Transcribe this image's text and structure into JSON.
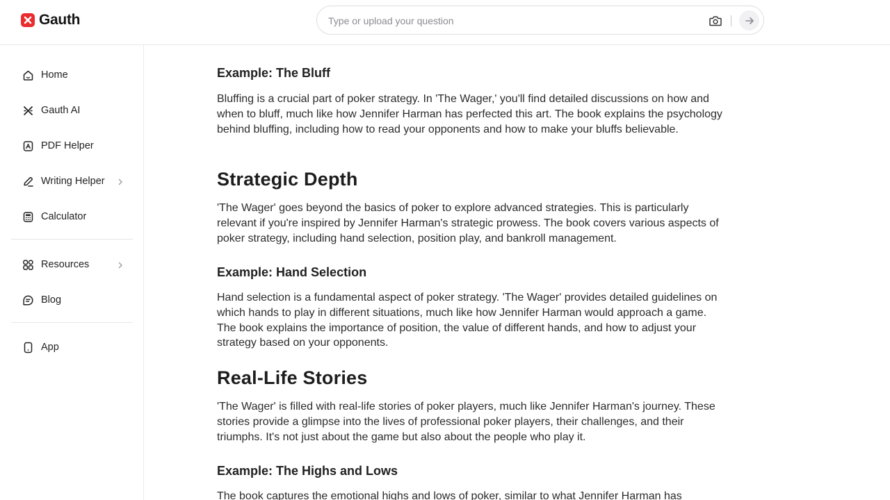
{
  "brand": {
    "name": "Gauth",
    "color": "#ea2c2f"
  },
  "search": {
    "placeholder": "Type or upload your question"
  },
  "icons": {
    "camera": "camera-icon",
    "send": "arrow-right-icon"
  },
  "sidebar": {
    "items": [
      {
        "label": "Home",
        "icon": "home-icon"
      },
      {
        "label": "Gauth AI",
        "icon": "gauth-ai-icon"
      },
      {
        "label": "PDF Helper",
        "icon": "pdf-icon"
      },
      {
        "label": "Writing Helper",
        "icon": "pen-icon",
        "has_submenu": true
      },
      {
        "label": "Calculator",
        "icon": "calculator-icon"
      },
      {
        "label": "Resources",
        "icon": "grid-icon",
        "has_submenu": true
      },
      {
        "label": "Blog",
        "icon": "blog-icon"
      },
      {
        "label": "App",
        "icon": "phone-icon"
      }
    ]
  },
  "article": {
    "sections": [
      {
        "heading": "Example: The Bluff",
        "level": 3,
        "body": "Bluffing is a crucial part of poker strategy. In 'The Wager,' you'll find detailed discussions on how and when to bluff, much like how Jennifer Harman has perfected this art. The book explains the psychology behind bluffing, including how to read your opponents and how to make your bluffs believable."
      },
      {
        "heading": "Strategic Depth",
        "level": 2,
        "body": "'The Wager' goes beyond the basics of poker to explore advanced strategies. This is particularly relevant if you're inspired by Jennifer Harman's strategic prowess. The book covers various aspects of poker strategy, including hand selection, position play, and bankroll management."
      },
      {
        "heading": "Example: Hand Selection",
        "level": 3,
        "body": "Hand selection is a fundamental aspect of poker strategy. 'The Wager' provides detailed guidelines on which hands to play in different situations, much like how Jennifer Harman would approach a game. The book explains the importance of position, the value of different hands, and how to adjust your strategy based on your opponents."
      },
      {
        "heading": "Real-Life Stories",
        "level": 2,
        "body": "'The Wager' is filled with real-life stories of poker players, much like Jennifer Harman's journey. These stories provide a glimpse into the lives of professional poker players, their challenges, and their triumphs. It's not just about the game but also about the people who play it."
      },
      {
        "heading": "Example: The Highs and Lows",
        "level": 3,
        "body": "The book captures the emotional highs and lows of poker, similar to what Jennifer Harman has"
      }
    ]
  }
}
